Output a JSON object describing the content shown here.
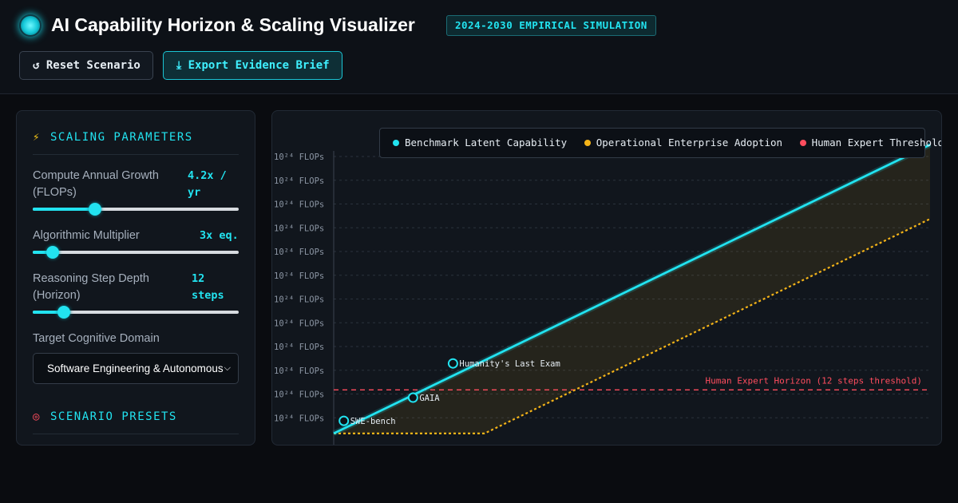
{
  "header": {
    "title": "AI Capability Horizon & Scaling Visualizer",
    "badge": "2024-2030 EMPIRICAL SIMULATION",
    "reset_label": "↺ Reset Scenario",
    "export_label": "⤓ Export Evidence Brief"
  },
  "sidebar": {
    "section_title": "SCALING PARAMETERS",
    "section_icon": "lightning-icon",
    "params": [
      {
        "label": "Compute Annual Growth (FLOPs)",
        "value": "4.2x / yr",
        "slider_fraction": 0.29
      },
      {
        "label": "Algorithmic Multiplier",
        "value": "3x eq.",
        "slider_fraction": 0.07
      },
      {
        "label": "Reasoning Step Depth (Horizon)",
        "value": "12 steps",
        "slider_fraction": 0.13
      }
    ],
    "domain_label": "Target Cognitive Domain",
    "domain_selected": "Software Engineering & Autonomous",
    "presets_title": "SCENARIO PRESETS",
    "presets_icon": "target-icon"
  },
  "colors": {
    "accent": "#22e3f0",
    "benchmark": "#22e3f0",
    "adoption": "#f5b418",
    "threshold": "#ff4d5e",
    "background": "#0a0c10",
    "panel": "#11161d"
  },
  "chart_data": {
    "type": "line",
    "legend": [
      {
        "name": "Benchmark Latent Capability",
        "color": "#22e3f0"
      },
      {
        "name": "Operational Enterprise Adoption",
        "color": "#f5b418"
      },
      {
        "name": "Human Expert Threshold",
        "color": "#ff4d5e"
      }
    ],
    "y_ticks": [
      "10²⁴ FLOPs",
      "10²⁴ FLOPs",
      "10²⁴ FLOPs",
      "10²⁴ FLOPs",
      "10²⁴ FLOPs",
      "10²⁴ FLOPs",
      "10²⁴ FLOPs",
      "10²⁴ FLOPs",
      "10²⁴ FLOPs",
      "10²⁴ FLOPs",
      "10²⁴ FLOPs",
      "10²⁴ FLOPs"
    ],
    "x_range": [
      0,
      1
    ],
    "y_range": [
      0,
      1
    ],
    "series": [
      {
        "name": "Benchmark Latent Capability",
        "x": [
          0,
          1
        ],
        "y": [
          0.035,
          0.93
        ]
      },
      {
        "name": "Operational Enterprise Adoption",
        "x": [
          0,
          0.253,
          1
        ],
        "y": [
          0.035,
          0.035,
          0.7
        ]
      }
    ],
    "threshold": {
      "y": 0.17,
      "label": "Human Expert Horizon (12 steps threshold)"
    },
    "benchmarks": [
      {
        "label": "SWE-bench",
        "x": 0.017,
        "y": 0.074
      },
      {
        "label": "GAIA",
        "x": 0.133,
        "y": 0.146
      },
      {
        "label": "Humanity's Last Exam",
        "x": 0.2,
        "y": 0.252
      }
    ],
    "grid": true,
    "legend_position": "top"
  }
}
